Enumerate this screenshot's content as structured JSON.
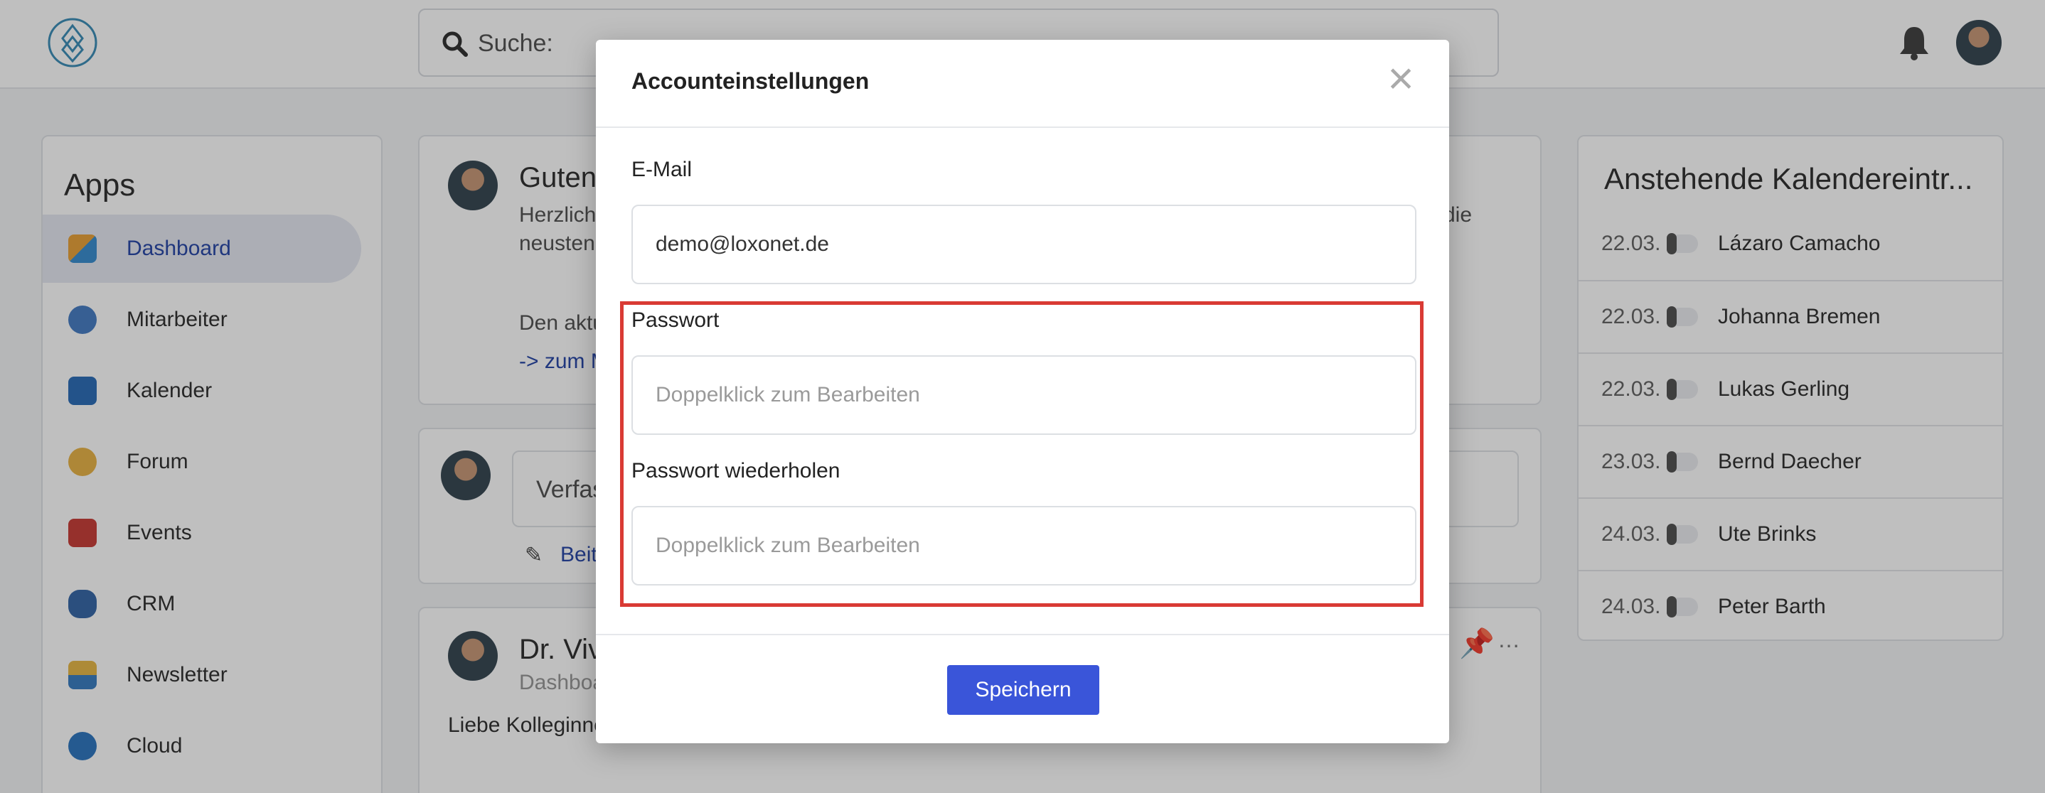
{
  "header": {
    "search_placeholder": "Suche:"
  },
  "apps": {
    "title": "Apps",
    "items": [
      {
        "label": "Dashboard",
        "icon": "dashboard-icon",
        "active": true
      },
      {
        "label": "Mitarbeiter",
        "icon": "people-icon"
      },
      {
        "label": "Kalender",
        "icon": "calendar-icon"
      },
      {
        "label": "Forum",
        "icon": "chat-icon"
      },
      {
        "label": "Events",
        "icon": "events-icon"
      },
      {
        "label": "CRM",
        "icon": "binoculars-icon"
      },
      {
        "label": "Newsletter",
        "icon": "envelope-icon"
      },
      {
        "label": "Cloud",
        "icon": "cloud-icon"
      }
    ]
  },
  "feed": {
    "welcome_title": "Guten",
    "welcome_line1": "Herzlich",
    "welcome_line1_end": "die",
    "welcome_line2": "neusten",
    "current": "Den aktu",
    "link": "-> zum M",
    "compose_placeholder": "Verfas",
    "post_link": "Beit",
    "post_author": "Dr. Viv",
    "post_sub": "Dashboa",
    "post_text": "Liebe Kolleginne"
  },
  "calendar": {
    "title": "Anstehende Kalendereintr...",
    "entries": [
      {
        "date": "22.03.",
        "name": "Lázaro Camacho"
      },
      {
        "date": "22.03.",
        "name": "Johanna Bremen"
      },
      {
        "date": "22.03.",
        "name": "Lukas Gerling"
      },
      {
        "date": "23.03.",
        "name": "Bernd Daecher"
      },
      {
        "date": "24.03.",
        "name": "Ute Brinks"
      },
      {
        "date": "24.03.",
        "name": "Peter Barth"
      }
    ]
  },
  "modal": {
    "title": "Accounteinstellungen",
    "close": "×",
    "email_label": "E-Mail",
    "email_value": "demo@loxonet.de",
    "password_label": "Passwort",
    "password_placeholder": "Doppelklick zum Bearbeiten",
    "password_repeat_label": "Passwort wiederholen",
    "password_repeat_placeholder": "Doppelklick zum Bearbeiten",
    "save_label": "Speichern"
  },
  "colors": {
    "accent": "#3a55d9",
    "highlight": "#d93a34",
    "active_nav": "#2b4aa8"
  }
}
